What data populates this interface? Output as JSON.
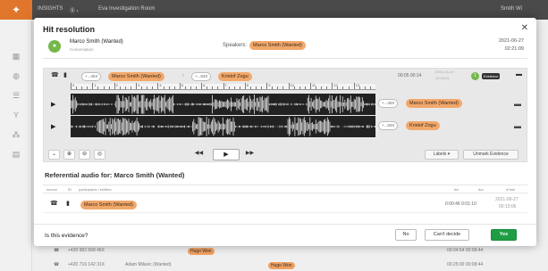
{
  "background": {
    "logo_icon": "app-logo-icon",
    "top_items": [
      "INSIGHTS",
      "Ⓑ ›",
      "Eva Investigation Room",
      "Smith Wi"
    ],
    "rows": [
      {
        "number": "+420 982 668 46X",
        "pill": "Hugo Won",
        "time": "00:04:54 00:08:44"
      },
      {
        "number": "+420 716 142 31X",
        "extra": "Adam Milavic (Wanted)",
        "pill": "Hugo Won",
        "time": "00:25:00 00:08:44"
      }
    ]
  },
  "modal": {
    "title": "Hit resolution",
    "close_icon": "close-icon",
    "hit": {
      "avatar_initial": "●",
      "name": "Marco Smith (Wanted)",
      "subtitle": "Conversation",
      "speakers_label": "Speakers:",
      "speakers_pill": "Marco Smith (Wanted)",
      "date": "2021-06-27",
      "time": "02:21:09"
    },
    "player": {
      "toolbar": {
        "phone_icon": "phone-icon",
        "number_a": "+...45X",
        "speaker_a": "Marco Smith (Wanted)",
        "arrow": "›",
        "number_b": "+...83X",
        "speaker_b": "Kristof Zogu",
        "duration": "00:05 00:14",
        "date": "2021-04-19",
        "date_time": "10:45:01",
        "count": "1",
        "evidence_badge": "Evidence"
      },
      "ruler_labels": [
        "0",
        "1",
        "2",
        "3",
        "4",
        "5",
        "6",
        "7",
        "8",
        "9",
        "10",
        "11",
        "12",
        "13"
      ],
      "tracks": [
        {
          "number": "+...45X",
          "speaker": "Marco Smith (Wanted)"
        },
        {
          "number": "+...83X",
          "speaker": "Kristof Zogu"
        }
      ],
      "controls": {
        "collapse": "⌄",
        "zoom_in": "⊕",
        "zoom_out": "⊖",
        "reset": "◎",
        "rewind": "◀◀",
        "play": "▶",
        "forward": "▶▶",
        "labels_btn": "Labels ▾",
        "unmark_btn": "Unmark Evidence"
      }
    },
    "referential": {
      "title": "Referential audio for: Marco Smith (Wanted)",
      "headers": {
        "source": "source",
        "id": "ID",
        "participants": "participants / entities",
        "len": "len",
        "dur": "dur",
        "date": "d*ime"
      },
      "row": {
        "pill": "Marco Smith (Wanted)",
        "duration": "0:00:46 0:01:10",
        "date": "2021-06-27",
        "time": "00:10:06"
      }
    },
    "footer": {
      "question": "Is this evidence?",
      "no": "No",
      "cant_decide": "Can't decide",
      "yes": "Yes"
    }
  }
}
